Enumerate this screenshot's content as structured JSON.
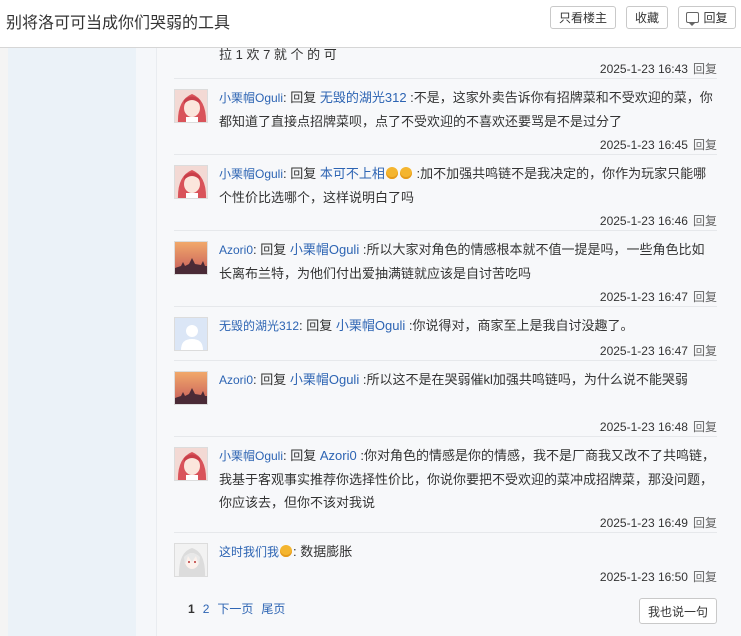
{
  "header": {
    "title": "别将洛可可当成你们哭弱的工具",
    "only_op_label": "只看楼主",
    "favorite_label": "收藏",
    "reply_label": "回复"
  },
  "cut_text": "拉 1 欢 7 就 个 的 可",
  "reply_link_label": "回复",
  "replies": [
    {
      "time": "2025-1-23 16:43"
    },
    {
      "user": "小栗帽Oguli",
      "connector": ": 回复 ",
      "target": "无毁的湖光312",
      "text": " :不是，这家外卖告诉你有招牌菜和不受欢迎的菜，你都知道了直接点招牌菜呗，点了不受欢迎的不喜欢还要骂是不是过分了",
      "time": "2025-1-23 16:45",
      "avatar": "red-hair-anime-avatar"
    },
    {
      "user": "小栗帽Oguli",
      "connector": ": 回复 ",
      "target": "本可不上相",
      "emoji": "smile-emoji",
      "text": " :加不加强共鸣链不是我决定的，你作为玩家只能哪个性价比选哪个，这样说明白了吗",
      "time": "2025-1-23 16:46",
      "avatar": "red-hair-anime-avatar"
    },
    {
      "user": "Azori0",
      "connector": ": 回复 ",
      "target": "小栗帽Oguli",
      "text": " :所以大家对角色的情感根本就不值一提是吗，一些角色比如长离布兰特，为他们付出爱抽满链就应该是自讨苦吃吗",
      "time": "2025-1-23 16:47",
      "avatar": "sunset-city-avatar"
    },
    {
      "user": "无毁的湖光312",
      "connector": ": 回复 ",
      "target": "小栗帽Oguli",
      "text": " :你说得对，商家至上是我自讨没趣了。",
      "time": "2025-1-23 16:47",
      "avatar": "default-user-avatar"
    },
    {
      "user": "Azori0",
      "connector": ": 回复 ",
      "target": "小栗帽Oguli",
      "text": " :所以这不是在哭弱催kl加强共鸣链吗，为什么说不能哭弱",
      "time": "2025-1-23 16:48",
      "avatar": "sunset-city-avatar"
    },
    {
      "user": "小栗帽Oguli",
      "connector": ": 回复 ",
      "target": "Azori0",
      "text": " :你对角色的情感是你的情感，我不是厂商我又改不了共鸣链，我基于客观事实推荐你选择性价比，你说你要把不受欢迎的菜冲成招牌菜，那没问题，你应该去，但你不该对我说",
      "time": "2025-1-23 16:49",
      "avatar": "red-hair-anime-avatar"
    },
    {
      "user": "这时我们我",
      "emoji": "smile-emoji",
      "connector": ": ",
      "text": "数据膨胀",
      "time": "2025-1-23 16:50",
      "avatar": "white-hair-anime-avatar"
    }
  ],
  "pager": {
    "current": "1",
    "page2": "2",
    "next": "下一页",
    "last": "尾页"
  },
  "say_button_label": "我也说一句",
  "colors": {
    "link": "#2d64b3",
    "sidebar": "#ebf2f8",
    "content_bg": "#f7f8fa"
  }
}
